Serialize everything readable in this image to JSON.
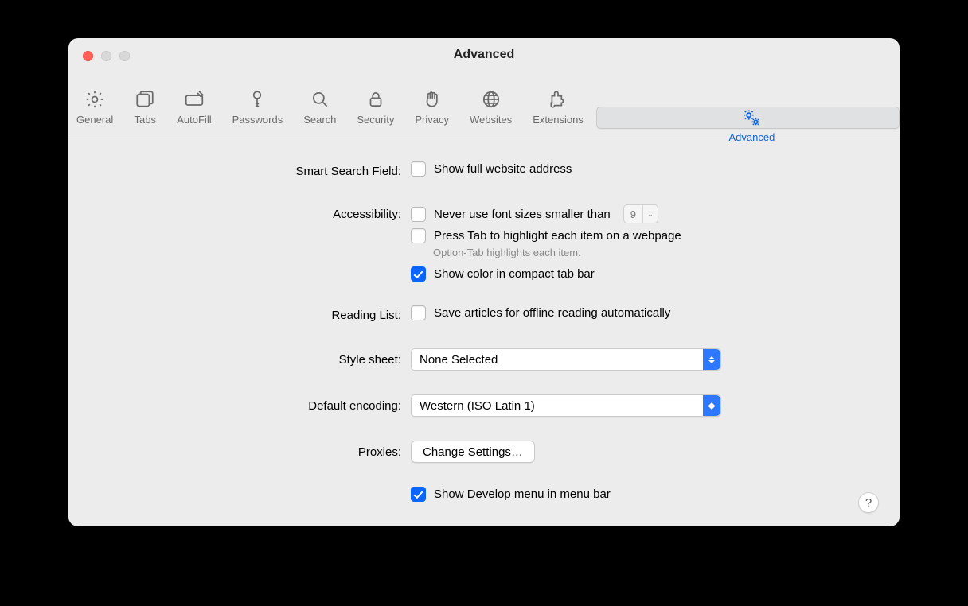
{
  "window": {
    "title": "Advanced"
  },
  "toolbar": {
    "items": [
      {
        "label": "General"
      },
      {
        "label": "Tabs"
      },
      {
        "label": "AutoFill"
      },
      {
        "label": "Passwords"
      },
      {
        "label": "Search"
      },
      {
        "label": "Security"
      },
      {
        "label": "Privacy"
      },
      {
        "label": "Websites"
      },
      {
        "label": "Extensions"
      },
      {
        "label": "Advanced"
      }
    ]
  },
  "labels": {
    "smart_search": "Smart Search Field:",
    "accessibility": "Accessibility:",
    "reading_list": "Reading List:",
    "style_sheet": "Style sheet:",
    "default_encoding": "Default encoding:",
    "proxies": "Proxies:"
  },
  "opts": {
    "show_full_address": "Show full website address",
    "never_font_smaller": "Never use font sizes smaller than",
    "font_size_value": "9",
    "press_tab": "Press Tab to highlight each item on a webpage",
    "press_tab_hint": "Option-Tab highlights each item.",
    "show_color_compact": "Show color in compact tab bar",
    "save_offline": "Save articles for offline reading automatically",
    "stylesheet_value": "None Selected",
    "encoding_value": "Western (ISO Latin 1)",
    "change_settings": "Change Settings…",
    "show_develop": "Show Develop menu in menu bar"
  },
  "help": "?"
}
